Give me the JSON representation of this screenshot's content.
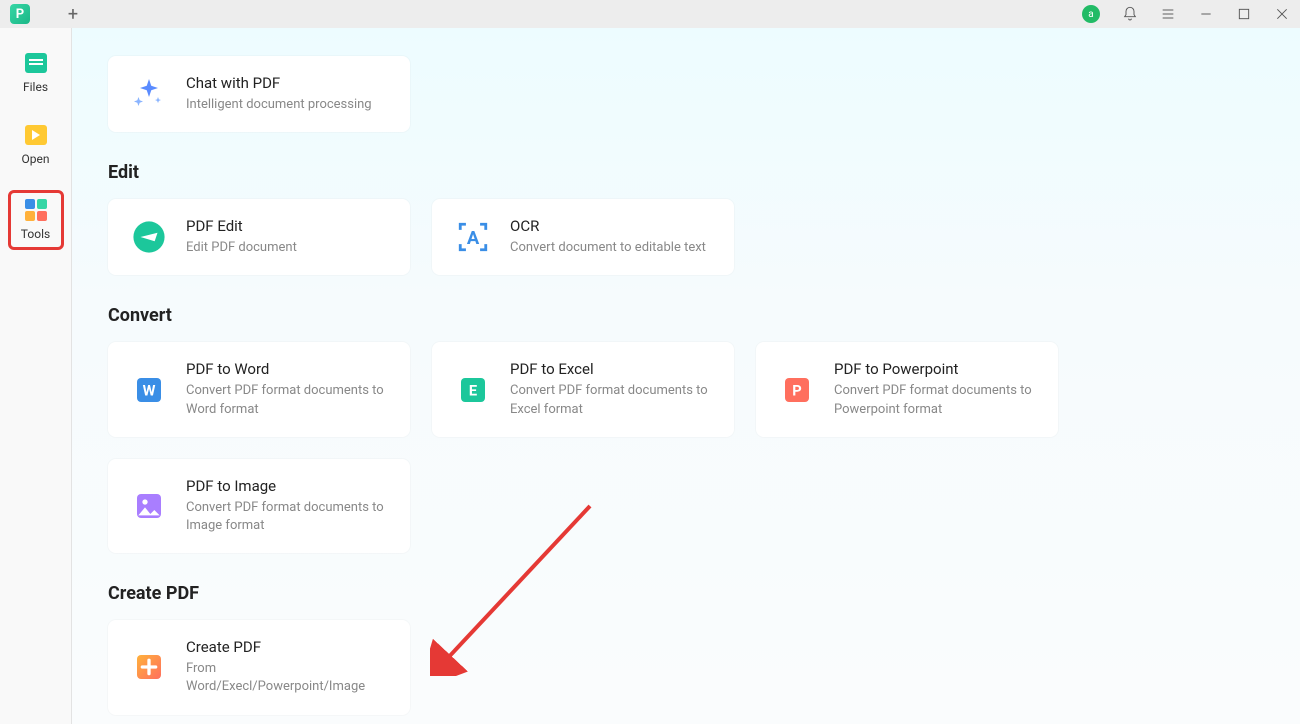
{
  "titlebar": {
    "avatar_letter": "a"
  },
  "sidebar": {
    "items": [
      {
        "label": "Files"
      },
      {
        "label": "Open"
      },
      {
        "label": "Tools"
      }
    ]
  },
  "top_card": {
    "title": "Chat with PDF",
    "desc": "Intelligent document processing"
  },
  "edit": {
    "heading": "Edit",
    "cards": [
      {
        "title": "PDF Edit",
        "desc": "Edit PDF document"
      },
      {
        "title": "OCR",
        "desc": "Convert document to editable text"
      }
    ]
  },
  "convert": {
    "heading": "Convert",
    "cards": [
      {
        "title": "PDF to Word",
        "desc": "Convert PDF format documents to Word format"
      },
      {
        "title": "PDF to Excel",
        "desc": "Convert PDF format documents to Excel format"
      },
      {
        "title": "PDF to Powerpoint",
        "desc": "Convert PDF format documents to Powerpoint format"
      },
      {
        "title": "PDF to Image",
        "desc": "Convert PDF format documents to Image format"
      }
    ]
  },
  "create": {
    "heading": "Create PDF",
    "cards": [
      {
        "title": "Create PDF",
        "desc": "From Word/Execl/Powerpoint/Image"
      }
    ]
  }
}
